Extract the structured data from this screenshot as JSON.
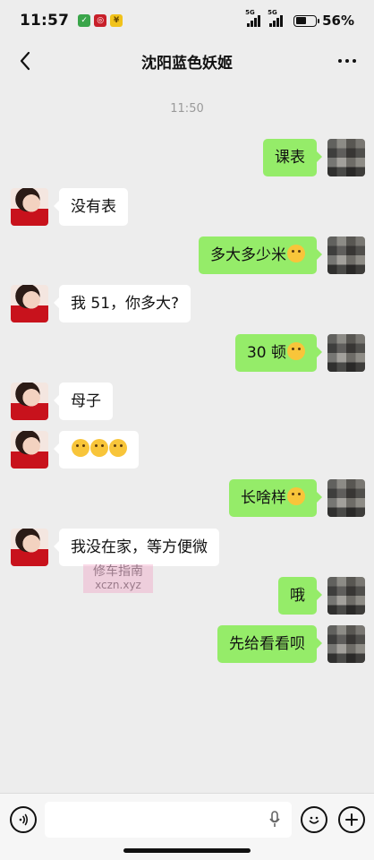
{
  "status": {
    "time": "11:57",
    "battery": "56%",
    "battery_level": 0.56,
    "signal_tags": [
      "5G",
      "5G"
    ]
  },
  "header": {
    "title": "沈阳蓝色妖姬"
  },
  "chat": {
    "timestamp": "11:50",
    "messages": [
      {
        "from": "me",
        "text": "课表"
      },
      {
        "from": "her",
        "text": "没有表"
      },
      {
        "from": "me",
        "text": "多大多少米"
      },
      {
        "from": "her",
        "text": "我 51，你多大?"
      },
      {
        "from": "me",
        "text": "30 顿"
      },
      {
        "from": "her",
        "text": "母子"
      },
      {
        "from": "her",
        "text": ""
      },
      {
        "from": "me",
        "text": "长啥样"
      },
      {
        "from": "her",
        "text": "我没在家，等方便微"
      },
      {
        "from": "me",
        "text": "哦"
      },
      {
        "from": "me",
        "text": "先给看看呗"
      }
    ],
    "watermark_line1": "修车指南",
    "watermark_line2": "xczn.xyz"
  },
  "icons": {
    "back": "chevron-left-icon",
    "more": "more-dots-icon",
    "voice": "voice-icon",
    "mic": "mic-icon",
    "emoji": "emoji-icon",
    "plus": "plus-icon"
  },
  "colors": {
    "bubble_out": "#95ec69",
    "bubble_in": "#ffffff",
    "background": "#ededed"
  }
}
